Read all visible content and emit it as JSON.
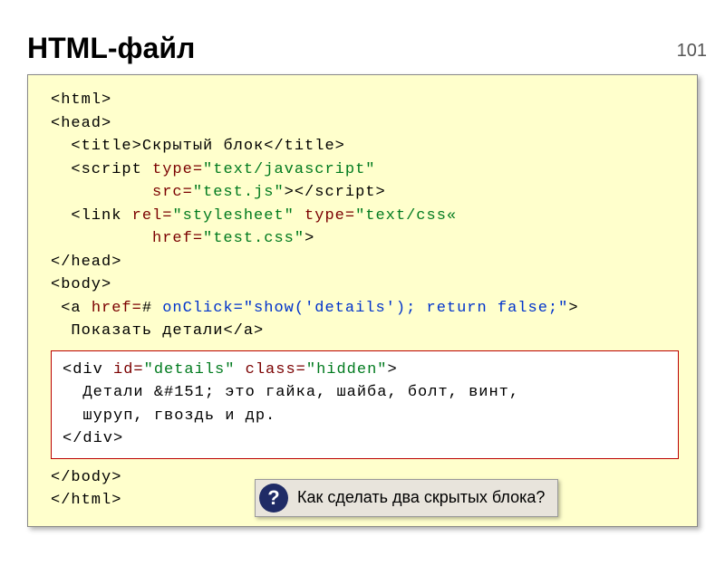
{
  "page_number": "101",
  "title": "HTML-файл",
  "code": {
    "l1": "<html>",
    "l2": "<head>",
    "l3a": "  <title>",
    "l3b": "Скрытый блок",
    "l3c": "</title>",
    "l4a": "  <script ",
    "l4b": "type=",
    "l4c": "\"text/javascript\"",
    "l5a": "          src=",
    "l5b": "\"test.js\"",
    "l5c": "></",
    "l5d": "script",
    "l5e": ">",
    "l6a": "  <link ",
    "l6b": "rel=",
    "l6c": "\"stylesheet\"",
    "l6d": " type=",
    "l6e": "\"text/css«",
    "l7a": "          href=",
    "l7b": "\"test.css\"",
    "l7c": ">",
    "l8": "</head>",
    "l9": "<body>",
    "l10a": " <a ",
    "l10b": "href=",
    "l10c": "# ",
    "l10d": "onClick=",
    "l10e": "\"show('details'); return false;\"",
    "l10f": ">",
    "l11a": "  Показать детали",
    "l11b": "</a>",
    "l12": "</body>",
    "l13": "</html>"
  },
  "inner": {
    "l1a": "<div ",
    "l1b": "id=",
    "l1c": "\"details\"",
    "l1d": " class=",
    "l1e": "\"hidden\"",
    "l1f": ">",
    "l2": "  Детали &#151; это гайка, шайба, болт, винт,",
    "l3": "  шуруп, гвоздь и др.",
    "l4": "</div>"
  },
  "question": {
    "icon": "?",
    "text": "Как сделать два скрытых блока?"
  }
}
